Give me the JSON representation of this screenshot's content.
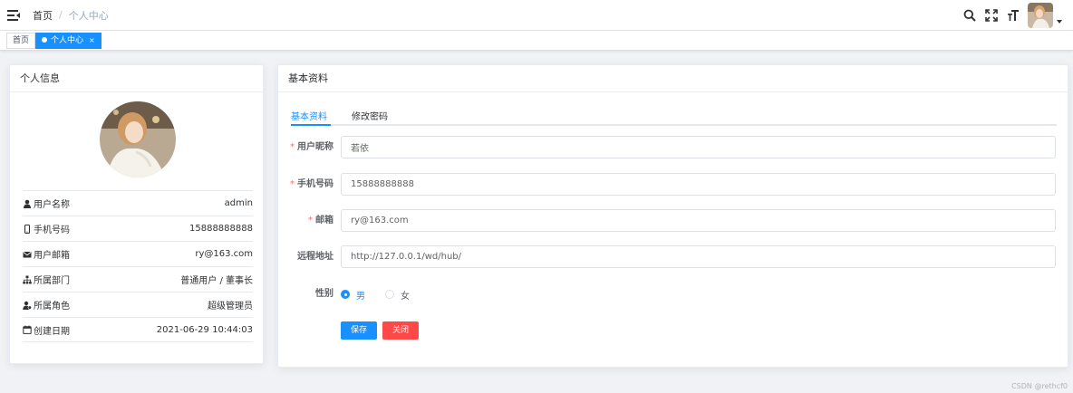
{
  "navbar": {
    "breadcrumb": {
      "home": "首页",
      "separator": "/",
      "current": "个人中心"
    },
    "icons": [
      "hamburger-icon",
      "search-icon",
      "fullscreen-icon",
      "font-size-icon"
    ]
  },
  "tags": [
    {
      "label": "首页",
      "active": false
    },
    {
      "label": "个人中心",
      "active": true,
      "close": "×"
    }
  ],
  "profile_card": {
    "title": "个人信息",
    "items": [
      {
        "icon": "user-icon",
        "label": "用户名称",
        "value": "admin"
      },
      {
        "icon": "phone-icon",
        "label": "手机号码",
        "value": "15888888888"
      },
      {
        "icon": "email-icon",
        "label": "用户邮箱",
        "value": "ry@163.com"
      },
      {
        "icon": "tree-icon",
        "label": "所属部门",
        "value": "普通用户 / 董事长"
      },
      {
        "icon": "role-icon",
        "label": "所属角色",
        "value": "超级管理员"
      },
      {
        "icon": "date-icon",
        "label": "创建日期",
        "value": "2021-06-29 10:44:03"
      }
    ]
  },
  "basic_card": {
    "title": "基本资料",
    "tabs": [
      {
        "label": "基本资料",
        "active": true
      },
      {
        "label": "修改密码",
        "active": false
      }
    ],
    "form": {
      "nickname": {
        "label": "用户昵称",
        "required": true,
        "value": "若依"
      },
      "phone": {
        "label": "手机号码",
        "required": true,
        "value": "15888888888"
      },
      "email": {
        "label": "邮箱",
        "required": true,
        "value": "ry@163.com"
      },
      "remote": {
        "label": "远程地址",
        "required": false,
        "value": "http://127.0.0.1/wd/hub/"
      },
      "gender": {
        "label": "性别",
        "options": [
          "男",
          "女"
        ],
        "selected": "男"
      }
    },
    "buttons": {
      "save": "保存",
      "close": "关闭"
    }
  },
  "watermark": "CSDN @rethcf0",
  "colors": {
    "primary": "#1890ff",
    "danger": "#ff4949",
    "required": "#f56c6c"
  }
}
